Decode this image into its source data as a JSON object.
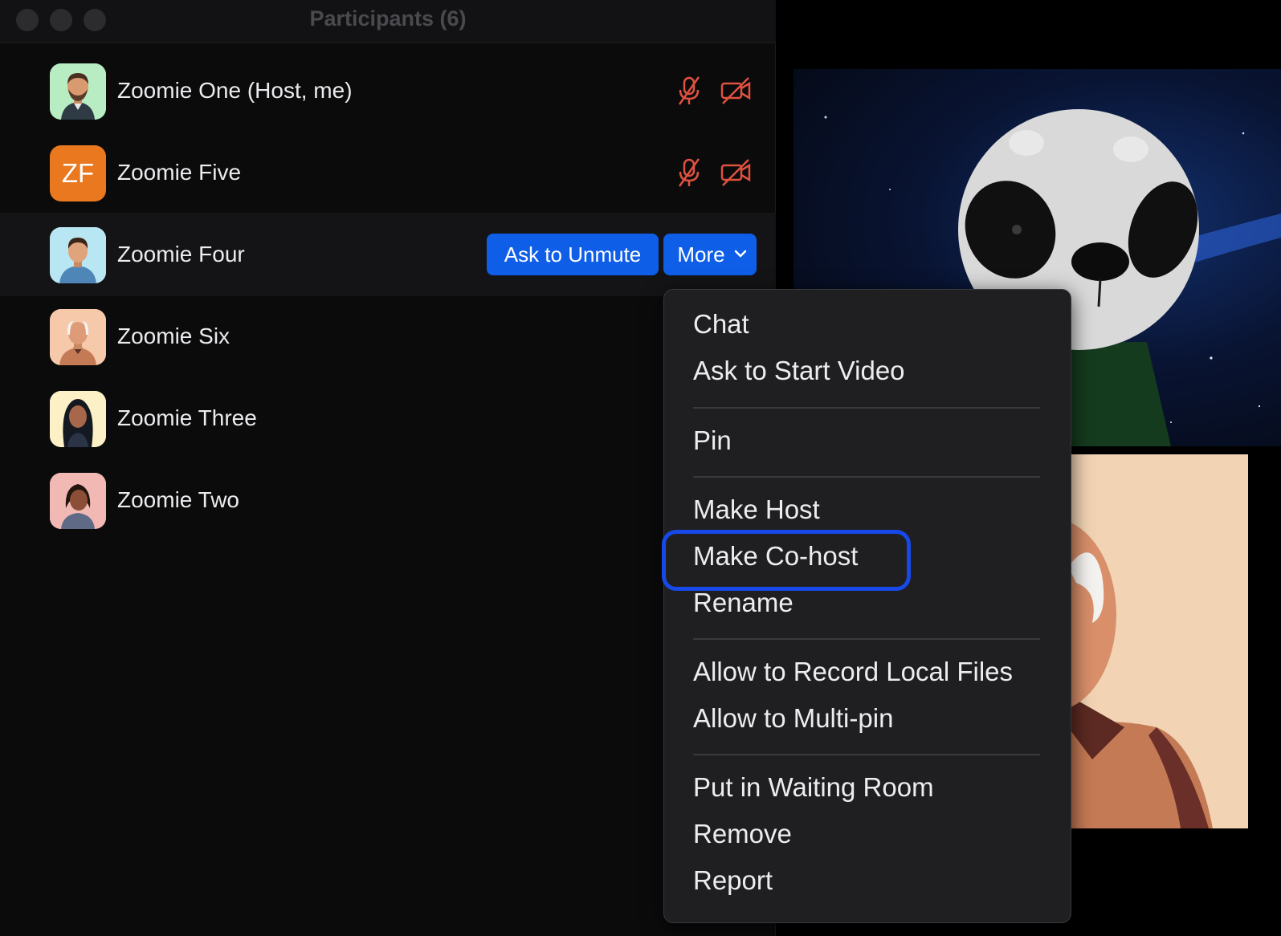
{
  "window": {
    "title": "Participants (6)"
  },
  "participants": [
    {
      "name": "Zoomie One (Host, me)",
      "avatar": "man-beard-avatar",
      "audio": "muted",
      "video": "off"
    },
    {
      "name": "Zoomie Five",
      "initials": "ZF",
      "audio": "muted",
      "video": "off"
    },
    {
      "name": "Zoomie Four",
      "avatar": "man-avatar",
      "hovered": true
    },
    {
      "name": "Zoomie Six",
      "avatar": "older-man-avatar"
    },
    {
      "name": "Zoomie Three",
      "avatar": "woman-long-hair-avatar"
    },
    {
      "name": "Zoomie Two",
      "avatar": "woman-avatar"
    }
  ],
  "row_actions": {
    "ask_to_unmute": "Ask to Unmute",
    "more": "More"
  },
  "menu": {
    "groups": [
      [
        "Chat",
        "Ask to Start Video"
      ],
      [
        "Pin"
      ],
      [
        "Make Host",
        "Make Co-host",
        "Rename"
      ],
      [
        "Allow to Record Local Files",
        "Allow to Multi-pin"
      ],
      [
        "Put in Waiting Room",
        "Remove",
        "Report"
      ]
    ],
    "highlighted_item": "Make Co-host"
  },
  "colors": {
    "accent_blue": "#0e5ee8",
    "focus_ring": "#1749e8",
    "muted_icon": "#e0523f",
    "initials_avatar": "#e9781f"
  }
}
